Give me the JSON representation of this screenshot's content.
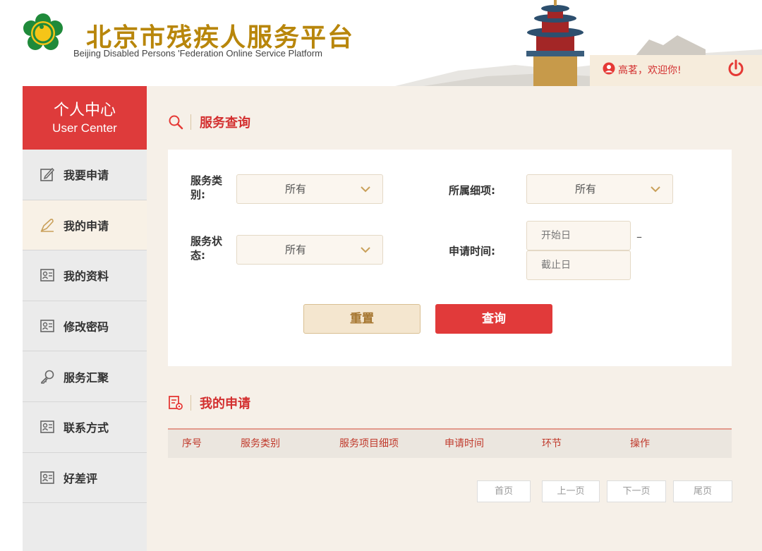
{
  "header": {
    "title": "北京市残疾人服务平台",
    "subtitle": "Beijing Disabled Persons 'Federation Online Service Platform",
    "greeting": "高茗，欢迎你!"
  },
  "sidebar": {
    "title": "个人中心",
    "subtitle": "User Center",
    "items": [
      {
        "label": "我要申请",
        "icon": "edit-icon"
      },
      {
        "label": "我的申请",
        "icon": "pen-icon",
        "active": true
      },
      {
        "label": "我的资料",
        "icon": "id-card-icon"
      },
      {
        "label": "修改密码",
        "icon": "id-card-icon"
      },
      {
        "label": "服务汇聚",
        "icon": "key-icon"
      },
      {
        "label": "联系方式",
        "icon": "id-card-icon"
      },
      {
        "label": "好差评",
        "icon": "id-card-icon"
      }
    ]
  },
  "query": {
    "title": "服务查询",
    "service_type_label": "服务类别:",
    "service_type_value": "所有",
    "sub_item_label": "所属细项:",
    "sub_item_value": "所有",
    "status_label": "服务状态:",
    "status_value": "所有",
    "apply_time_label": "申请时间:",
    "start_placeholder": "开始日",
    "end_placeholder": "截止日",
    "range_dash": "–",
    "reset_label": "重置",
    "query_label": "查询"
  },
  "applications": {
    "title": "我的申请",
    "columns": [
      "序号",
      "服务类别",
      "服务项目细项",
      "申请时间",
      "环节",
      "操作"
    ]
  },
  "pagination": {
    "first": "首页",
    "prev": "上一页",
    "next": "下一页",
    "last": "尾页"
  },
  "colors": {
    "accent_red": "#de3b3b",
    "title_gold": "#b8860b",
    "panel_beige": "#f6f0e8"
  }
}
